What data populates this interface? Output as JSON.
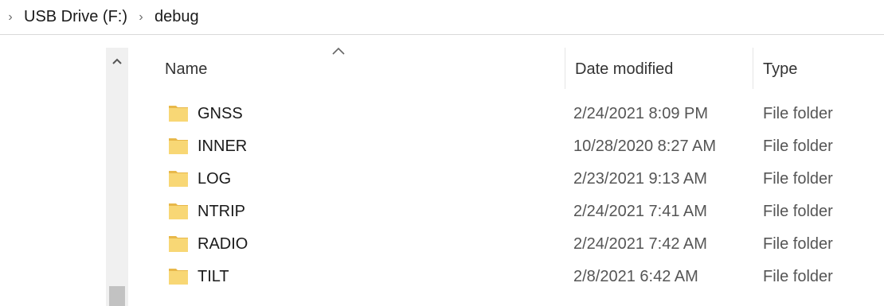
{
  "breadcrumb": {
    "items": [
      "USB Drive (F:)",
      "debug"
    ]
  },
  "columns": {
    "name": "Name",
    "date": "Date modified",
    "type": "Type"
  },
  "rows": [
    {
      "name": "GNSS",
      "date": "2/24/2021 8:09 PM",
      "type": "File folder"
    },
    {
      "name": "INNER",
      "date": "10/28/2020 8:27 AM",
      "type": "File folder"
    },
    {
      "name": "LOG",
      "date": "2/23/2021 9:13 AM",
      "type": "File folder"
    },
    {
      "name": "NTRIP",
      "date": "2/24/2021 7:41 AM",
      "type": "File folder"
    },
    {
      "name": "RADIO",
      "date": "2/24/2021 7:42 AM",
      "type": "File folder"
    },
    {
      "name": "TILT",
      "date": "2/8/2021 6:42 AM",
      "type": "File folder"
    }
  ],
  "colors": {
    "folder": "#f8d775",
    "folder_dark": "#e8b84a"
  }
}
